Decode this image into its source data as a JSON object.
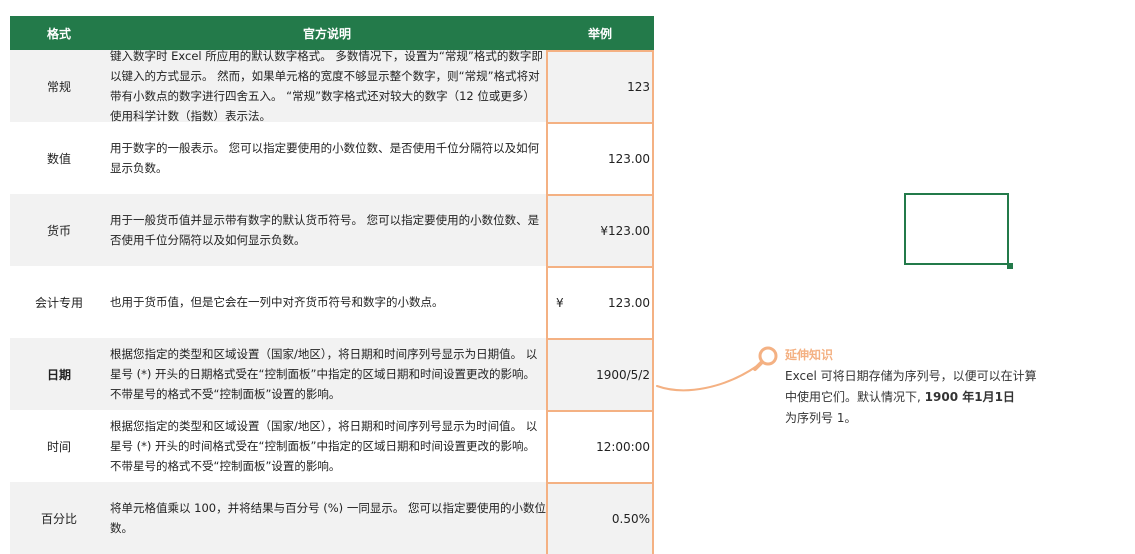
{
  "header": {
    "format": "格式",
    "description": "官方说明",
    "example": "举例"
  },
  "rows": [
    {
      "format": "常规",
      "description": "键入数字时 Excel 所应用的默认数字格式。 多数情况下，设置为“常规”格式的数字即以键入的方式显示。 然而，如果单元格的宽度不够显示整个数字，则“常规”格式将对带有小数点的数字进行四舍五入。 “常规”数字格式还对较大的数字（12 位或更多）使用科学计数（指数）表示法。",
      "example": "123"
    },
    {
      "format": "数值",
      "description": "用于数字的一般表示。 您可以指定要使用的小数位数、是否使用千位分隔符以及如何显示负数。",
      "example": "123.00"
    },
    {
      "format": "货币",
      "description": "用于一般货币值并显示带有数字的默认货币符号。 您可以指定要使用的小数位数、是否使用千位分隔符以及如何显示负数。",
      "example": "¥123.00"
    },
    {
      "format": "会计专用",
      "description": "也用于货币值，但是它会在一列中对齐货币符号和数字的小数点。",
      "example_symbol": "¥",
      "example": "123.00"
    },
    {
      "format": "日期",
      "description": "根据您指定的类型和区域设置（国家/地区），将日期和时间序列号显示为日期值。 以星号 (*) 开头的日期格式受在“控制面板”中指定的区域日期和时间设置更改的影响。 不带星号的格式不受“控制面板”设置的影响。",
      "example": "1900/5/2"
    },
    {
      "format": "时间",
      "description": "根据您指定的类型和区域设置（国家/地区），将日期和时间序列号显示为时间值。 以星号 (*) 开头的时间格式受在“控制面板”中指定的区域日期和时间设置更改的影响。 不带星号的格式不受“控制面板”设置的影响。",
      "example": "12:00:00"
    },
    {
      "format": "百分比",
      "description": "将单元格值乘以 100，并将结果与百分号 (%) 一同显示。 您可以指定要使用的小数位数。",
      "example": "0.50%"
    }
  ],
  "note": {
    "title": "延伸知识",
    "body_prefix": "Excel 可将日期存储为序列号，以便可以在计算中使用它们。默认情况下,",
    "body_bold": "1900 年1月1日",
    "body_suffix": "为序列号 1。"
  },
  "colors": {
    "header": "#237a4a",
    "accent": "#f4b183"
  },
  "icons": {
    "note_icon": "magnifier-icon"
  }
}
